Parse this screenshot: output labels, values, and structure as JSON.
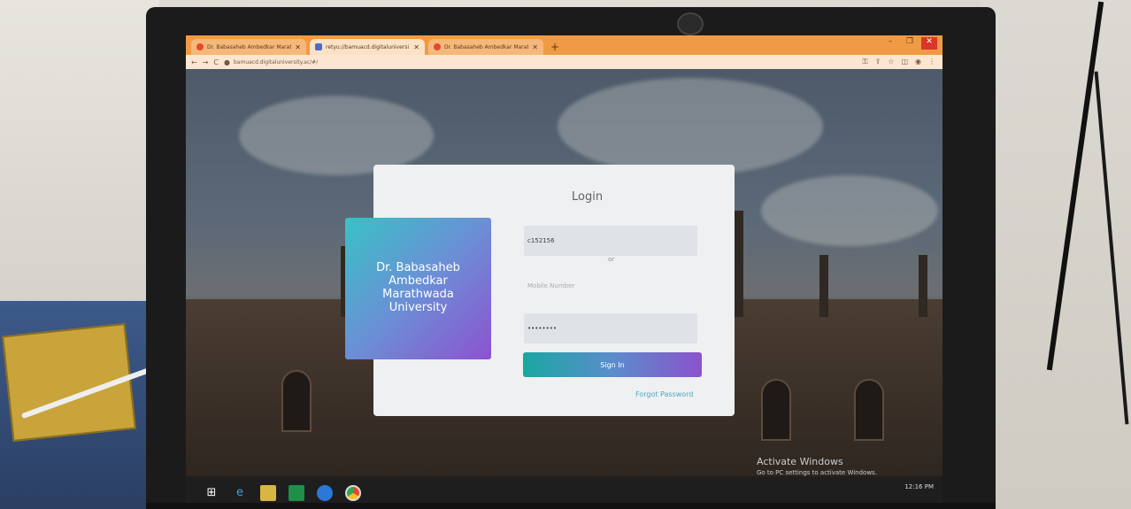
{
  "browser": {
    "tabs": [
      {
        "label": "Dr. Babasaheb Ambedkar Marat",
        "active": false
      },
      {
        "label": "retyu://bamuacd.digitaluniversi",
        "active": true
      },
      {
        "label": "Dr. Babasaheb Ambedkar Marat",
        "active": false
      }
    ],
    "new_tab": "+",
    "url": "bamuacd.digitaluniversity.ac/#/",
    "window_controls": {
      "minimize": "–",
      "maximize": "❐",
      "close": "✕"
    }
  },
  "login": {
    "title": "Login",
    "university_name": "Dr. Babasaheb Ambedkar Marathwada University",
    "username_value": "c152156",
    "or_label": "or",
    "mobile_placeholder": "Mobile Number",
    "password_value": "••••••••",
    "sign_in_label": "Sign In",
    "forgot_password_label": "Forgot Password"
  },
  "watermark": {
    "heading": "Activate Windows",
    "subtext": "Go to PC settings to activate Windows."
  },
  "taskbar": {
    "time": "12:16 PM",
    "icons": [
      "windows-start-icon",
      "internet-explorer-icon",
      "file-explorer-icon",
      "store-icon",
      "edge-icon",
      "chrome-icon"
    ]
  },
  "colors": {
    "titlebar": "#f09a45",
    "signin_gradient_start": "#1aa7a2",
    "signin_gradient_end": "#8c52cc",
    "logo_gradient_start": "#39c2c4",
    "logo_gradient_end": "#8d52cf"
  }
}
